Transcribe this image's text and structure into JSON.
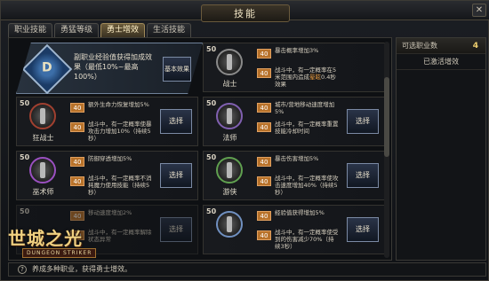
{
  "window": {
    "title": "技能",
    "close_label": "✕"
  },
  "tabs": [
    {
      "label": "职业技能",
      "active": false
    },
    {
      "label": "勇猛等级",
      "active": false
    },
    {
      "label": "勇士增效",
      "active": true
    },
    {
      "label": "生活技能",
      "active": false
    }
  ],
  "banner": {
    "emblem": "D",
    "text": "副职业经验值获得加成效果（最低10%~最高100%）",
    "button": "基本效果"
  },
  "classes": [
    {
      "level": "50",
      "name": "战士",
      "button": "",
      "effects": [
        {
          "badge": "40",
          "text": "暴击概率增加3%"
        },
        {
          "badge": "40",
          "text": "战斗中，有一定概率在5米范围内造成",
          "hl": "晕眩",
          "tail": "0.4秒效果"
        }
      ]
    },
    {
      "level": "50",
      "name": "狂战士",
      "button": "选择",
      "effects": [
        {
          "badge": "40",
          "text": "额外生命力恢复增加5%"
        },
        {
          "badge": "40",
          "text": "战斗中，有一定概率使",
          "hl": "",
          "tail": "暴攻击力增加10%（持续5秒）"
        }
      ]
    },
    {
      "level": "50",
      "name": "法师",
      "button": "选择",
      "effects": [
        {
          "badge": "40",
          "text": "城市/营地移动速度增加5%"
        },
        {
          "badge": "40",
          "text": "战斗中，有一定概率重置技能冷却时间",
          "hl": "",
          "tail": ""
        }
      ]
    },
    {
      "level": "50",
      "name": "巫术师",
      "button": "选择",
      "effects": [
        {
          "badge": "40",
          "text": "防御穿透增加5%"
        },
        {
          "badge": "40",
          "text": "战斗中，有一定概率不消耗魔力使用技能（持续5秒）",
          "hl": "",
          "tail": ""
        }
      ]
    },
    {
      "level": "50",
      "name": "游侠",
      "button": "选择",
      "effects": [
        {
          "badge": "40",
          "text": "暴击伤害增加5%"
        },
        {
          "badge": "40",
          "text": "战斗中，有一定概率使攻击速度增加40%（持续5秒）",
          "hl": "",
          "tail": ""
        }
      ]
    },
    {
      "level": "50",
      "name": "",
      "button": "选择",
      "effects": [
        {
          "badge": "40",
          "text": "移动速度增加2%"
        },
        {
          "badge": "40",
          "text": "战斗中，有一定概率解除状态异常",
          "hl": "",
          "tail": ""
        }
      ]
    },
    {
      "level": "50",
      "name": "",
      "button": "选择",
      "effects": [
        {
          "badge": "40",
          "text": "经验值获得增加5%"
        },
        {
          "badge": "40",
          "text": "战斗中，有一定概率使受到的伤害减少70%（持续3秒）",
          "hl": "",
          "tail": ""
        }
      ]
    }
  ],
  "right_panel": {
    "selectable_label": "可选职业数",
    "selectable_count": "4",
    "active_label": "已激活增效"
  },
  "bottom": {
    "help": "?",
    "text": "养成多种职业，获得勇士增效。"
  },
  "logo": {
    "main": "世城之光",
    "sub": "DUNGEON STRIKER"
  },
  "colors": {
    "accent": "#b8722a",
    "panel": "#0e1013",
    "border": "#3a3935"
  }
}
